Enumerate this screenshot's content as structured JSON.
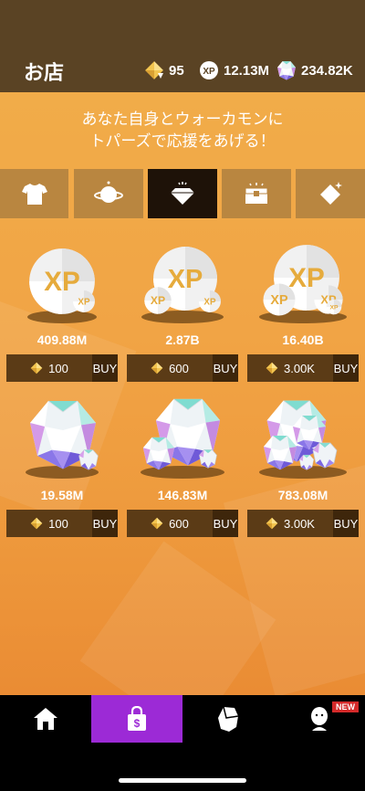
{
  "header": {
    "title": "お店",
    "currencies": [
      {
        "icon": "topaz-icon",
        "value": "95"
      },
      {
        "icon": "xp-icon",
        "value": "12.13M"
      },
      {
        "icon": "gem-icon",
        "value": "234.82K"
      }
    ]
  },
  "banner": {
    "line1": "あなた自身とウォーカモンに",
    "line2": "トパーズで応援をあげる！"
  },
  "tabs": [
    {
      "icon": "tshirt-icon",
      "active": false
    },
    {
      "icon": "planet-icon",
      "active": false
    },
    {
      "icon": "gem-icon",
      "active": true
    },
    {
      "icon": "treasure-chest-icon",
      "active": false
    },
    {
      "icon": "topaz-icon",
      "active": false
    }
  ],
  "items": [
    {
      "icon": "xp-coin-icon",
      "amount": "409.88M",
      "cost": "100",
      "buy_label": "BUY"
    },
    {
      "icon": "xp-coins-icon",
      "amount": "2.87B",
      "cost": "600",
      "buy_label": "BUY"
    },
    {
      "icon": "xp-coin-pile-icon",
      "amount": "16.40B",
      "cost": "3.00K",
      "buy_label": "BUY"
    },
    {
      "icon": "gem-icon",
      "amount": "19.58M",
      "cost": "100",
      "buy_label": "BUY"
    },
    {
      "icon": "gems-icon",
      "amount": "146.83M",
      "cost": "600",
      "buy_label": "BUY"
    },
    {
      "icon": "gem-pile-icon",
      "amount": "783.08M",
      "cost": "3.00K",
      "buy_label": "BUY"
    }
  ],
  "bottom_nav": [
    {
      "icon": "home-icon",
      "active": false
    },
    {
      "icon": "shopping-bag-icon",
      "active": true
    },
    {
      "icon": "walkamon-icon",
      "active": false
    },
    {
      "icon": "avatar-icon",
      "active": false,
      "badge": "NEW"
    }
  ],
  "colors": {
    "header_bg": "#5a4324",
    "main_bg": "#f1a445",
    "tab_bg": "#b98640",
    "tab_active_bg": "#1e1208",
    "buy_bar_bg": "#5b3b16",
    "nav_active": "#9c2ad6",
    "badge": "#d42a2a"
  }
}
